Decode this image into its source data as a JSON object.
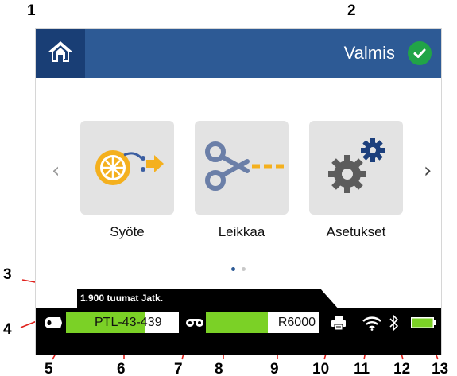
{
  "callouts": {
    "c1": "1",
    "c2": "2",
    "c3": "3",
    "c4": "4",
    "c5": "5",
    "c6": "6",
    "c7": "7",
    "c8": "8",
    "c9": "9",
    "c10": "10",
    "c11": "11",
    "c12": "12",
    "c13": "13"
  },
  "header": {
    "home_icon": "home-icon",
    "status": "Valmis",
    "status_icon": "check-icon",
    "colors": {
      "bar": "#2d5a95",
      "home": "#193e75",
      "status_ok": "#21a447"
    }
  },
  "carousel": {
    "prev_icon": "chevron-left-icon",
    "next_icon": "chevron-right-icon",
    "tiles": [
      {
        "label": "Syöte",
        "icon": "feed-icon"
      },
      {
        "label": "Leikkaa",
        "icon": "scissors-icon"
      },
      {
        "label": "Asetukset",
        "icon": "gears-icon"
      }
    ],
    "page_count": 2,
    "current_page": 1
  },
  "statusbar": {
    "tab_text": "1.900 tuumat Jatk.",
    "label_icon": "label-roll-icon",
    "label_name": "PTL-43-439",
    "label_remaining": 0.7,
    "ribbon_icon": "ribbon-icon",
    "ribbon_name": "R6000",
    "ribbon_remaining": 0.55,
    "printer_icon": "printer-icon",
    "wifi_icon": "wifi-icon",
    "bluetooth_icon": "bluetooth-icon",
    "battery_icon": "battery-icon",
    "battery_level": 1.0,
    "colors": {
      "fill": "#7bd126",
      "accent": "#f4b01e"
    }
  }
}
